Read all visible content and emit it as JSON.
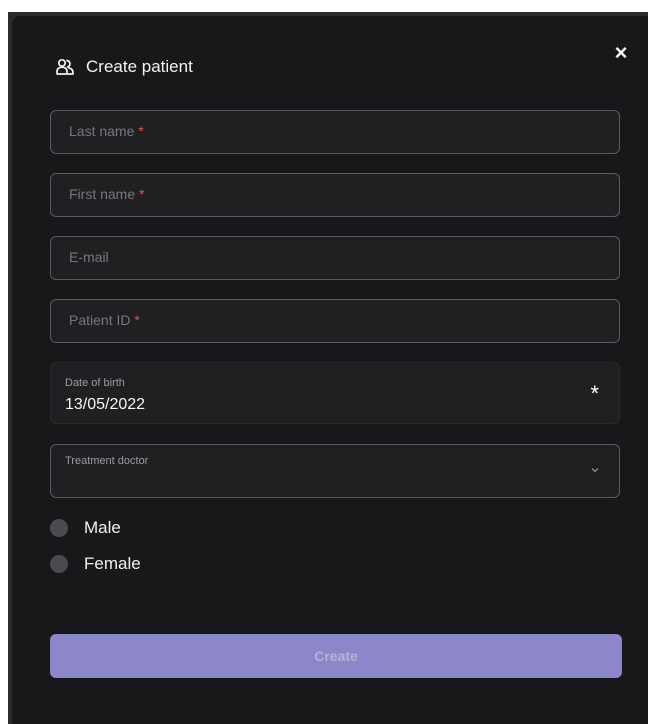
{
  "dialog": {
    "title": "Create patient",
    "title_icon": "user-group-icon",
    "close_label": "×"
  },
  "form": {
    "last_name": {
      "label": "Last name",
      "required_mark": "*",
      "value": ""
    },
    "first_name": {
      "label": "First name",
      "required_mark": "*",
      "value": ""
    },
    "email": {
      "label": "E-mail",
      "value": ""
    },
    "patient_id": {
      "label": "Patient ID",
      "required_mark": "*",
      "value": ""
    },
    "date_of_birth": {
      "label": "Date of birth",
      "value": "13/05/2022",
      "required_mark": "*"
    },
    "treatment_doctor": {
      "label": "Treatment doctor",
      "value": ""
    },
    "gender_options": [
      {
        "label": "Male",
        "selected": false
      },
      {
        "label": "Female",
        "selected": false
      }
    ],
    "submit_label": "Create"
  },
  "colors": {
    "modal_bg": "#18181b",
    "field_bg": "#202023",
    "field_border": "#5a5a60",
    "required": "#e05252",
    "button_bg": "#8c87c8",
    "button_text": "#b5b2d7"
  }
}
